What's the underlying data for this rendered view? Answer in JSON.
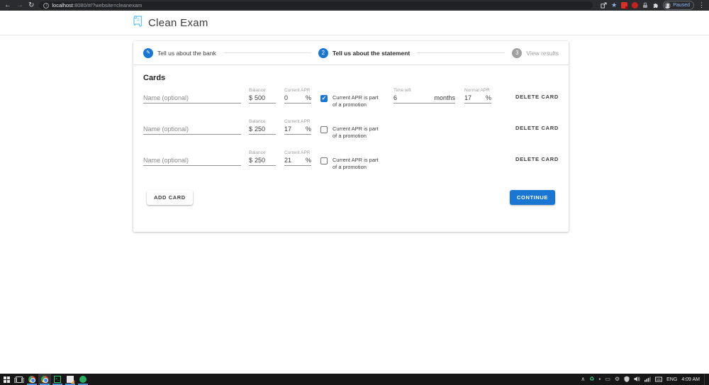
{
  "browser": {
    "back_icon": "←",
    "forward_icon": "→",
    "reload_icon": "↻",
    "url_host": "localhost",
    "url_rest": ":8080/#/?website=cleanexam",
    "star_icon": "★",
    "paused_label": "Paused",
    "menu_icon": "⋮"
  },
  "header": {
    "title": "Clean Exam"
  },
  "stepper": {
    "step1_icon": "✎",
    "step1_label": "Tell us about the bank",
    "step2_number": "2",
    "step2_label": "Tell us about the statement",
    "step3_number": "3",
    "step3_label": "View results"
  },
  "cards": {
    "heading": "Cards",
    "labels": {
      "balance": "Balance",
      "current_apr": "Current APR",
      "time_left": "Time left",
      "normal_apr": "Normal APR"
    },
    "promo_line1": "Current APR is part",
    "promo_line2": "of a promotion",
    "check_icon": "✓",
    "rows": [
      {
        "name_placeholder": "Name (optional)",
        "balance_prefix": "$",
        "balance": "500",
        "apr": "0",
        "apr_suffix": "%",
        "promo_checked": true,
        "time_left": "6",
        "time_left_suffix": "months",
        "normal_apr": "17",
        "normal_apr_suffix": "%",
        "delete_label": "DELETE CARD"
      },
      {
        "name_placeholder": "Name (optional)",
        "balance_prefix": "$",
        "balance": "250",
        "apr": "17",
        "apr_suffix": "%",
        "promo_checked": false,
        "delete_label": "DELETE CARD"
      },
      {
        "name_placeholder": "Name (optional)",
        "balance_prefix": "$",
        "balance": "250",
        "apr": "21",
        "apr_suffix": "%",
        "promo_checked": false,
        "delete_label": "DELETE CARD"
      }
    ],
    "add_card_label": "ADD CARD",
    "continue_label": "CONTINUE"
  },
  "taskbar": {
    "tray_chevron": "∧",
    "tray_sync": "♻",
    "tray_dot": "●",
    "tray_box": "▭",
    "tray_gear": "⚙",
    "lang": "ENG",
    "time": "4:09 AM"
  },
  "colors": {
    "primary": "#1976d2",
    "app_icon_blue": "#64c5f0",
    "taskbar_underline": "#4a90d9"
  }
}
